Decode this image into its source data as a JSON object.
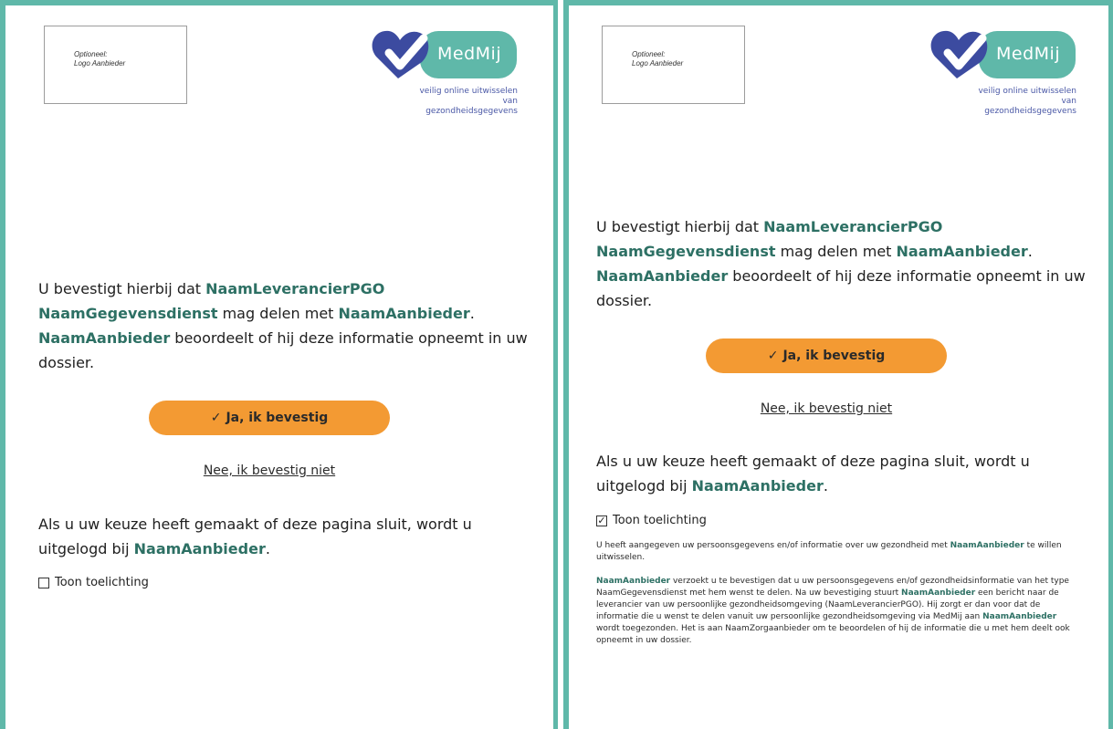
{
  "colors": {
    "accent": "#5fb8a9",
    "highlight": "#2d7064",
    "button": "#f39a33",
    "brand_blue": "#3c4ba0"
  },
  "logo_placeholder": {
    "line1": "Optioneel:",
    "line2": "Logo Aanbieder"
  },
  "medmij": {
    "brand": "MedMij",
    "tagline1": "veilig online uitwisselen",
    "tagline2": "van gezondheidsgegevens"
  },
  "confirmation": {
    "prefix": "U bevestigt hierbij dat ",
    "pgo": "NaamLeverancierPGO",
    "dienst": "NaamGegevensdienst",
    "mid": " mag delen met ",
    "aanbieder": "NaamAanbieder",
    "dot": ".",
    "suffix": " beoordeelt of hij deze informatie opneemt in uw dossier."
  },
  "buttons": {
    "check_icon": "✓",
    "confirm_label": "Ja, ik bevestig",
    "decline_label": "Nee, ik bevestig niet"
  },
  "logout": {
    "text": "Als u uw keuze heeft gemaakt of deze pagina sluit, wordt u uitgelogd bij ",
    "aanbieder": "NaamAanbieder",
    "dot": "."
  },
  "toggle": {
    "label": "Toon toelichting",
    "left_checked": false,
    "right_checked": true,
    "checkmark": "✓"
  },
  "explanation": {
    "p1_a": "U heeft aangegeven uw persoonsgegevens en/of informatie over uw gezondheid met ",
    "p1_aanbieder": "NaamAanbieder",
    "p1_b": " te willen uitwisselen.",
    "p2_aanbieder1": "NaamAanbieder",
    "p2_a": " verzoekt u te bevestigen dat u uw persoonsgegevens en/of gezondheidsinformatie van het type NaamGegevensdienst met hem wenst te delen. Na uw bevestiging stuurt ",
    "p2_aanbieder2": "NaamAanbieder",
    "p2_b": " een bericht naar de leverancier van uw persoonlijke gezondheidsomgeving (NaamLeverancierPGO). Hij zorgt er dan voor dat de informatie die u wenst te delen vanuit uw persoonlijke gezondheidsomgeving via MedMij aan ",
    "p2_aanbieder3": "NaamAanbieder",
    "p2_c": " wordt toegezonden. Het is aan NaamZorgaanbieder om te beoordelen of hij de informatie die u met hem deelt ook opneemt in uw dossier."
  }
}
